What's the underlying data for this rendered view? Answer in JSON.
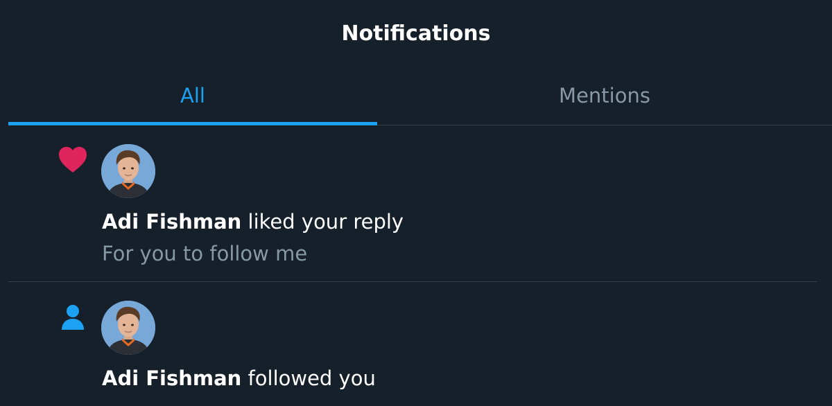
{
  "header": {
    "title": "Notifications"
  },
  "tabs": [
    {
      "label": "All",
      "active": true
    },
    {
      "label": "Mentions",
      "active": false
    }
  ],
  "notifications": [
    {
      "type_icon": "heart-icon",
      "user_name": "Adi Fishman",
      "action": " liked your reply",
      "preview": "For you to follow me"
    },
    {
      "type_icon": "person-icon",
      "user_name": "Adi Fishman",
      "action": " followed you"
    }
  ],
  "colors": {
    "background": "#15202b",
    "accent": "#1da1f2",
    "like": "#e0245e",
    "muted": "#8899a6",
    "divider": "#38444d"
  }
}
